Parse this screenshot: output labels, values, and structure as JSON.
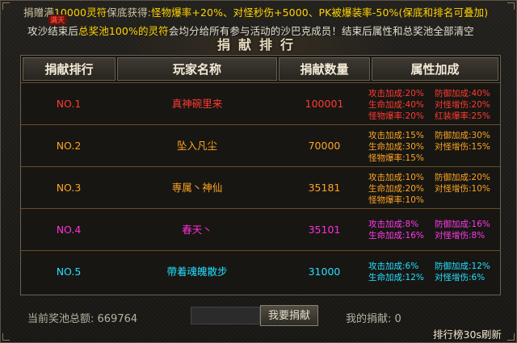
{
  "notice": {
    "line1_prefix": "捐赠满",
    "line1_amount": "10000灵符",
    "line1_mid": "保底获得:",
    "line1_rewards": "怪物爆率+20%、对怪秒伤+5000、PK被爆装率-50%(保底和排名可叠加)",
    "line2_a": "攻沙结束后",
    "line2_b": "总奖池100%的灵符",
    "line2_c": "会均分给所有参与活动的沙巴克成员！结束后属性和总奖池全部清空",
    "tag": "满天"
  },
  "title": "捐献排行",
  "headers": [
    "捐献排行",
    "玩家名称",
    "捐献数量",
    "属性加成"
  ],
  "colors": {
    "rank_red": "#ff3b2f",
    "rank_orange": "#ffa422",
    "rank_magenta": "#ff2fd6",
    "rank_cyan": "#24e0ff",
    "attr_red": "#ff3b2f",
    "attr_orange": "#ffa422",
    "attr_magenta": "#ff3be8",
    "attr_cyan": "#24e0ff"
  },
  "rows": [
    {
      "rank": "NO.1",
      "name": "真神碗里来",
      "amount": "100001",
      "attrs": [
        "攻击加成:20%",
        "防御加成:40%",
        "生命加成:40%",
        "对怪增伤:20%",
        "怪物爆率:20%",
        "红装爆率:25%"
      ]
    },
    {
      "rank": "NO.2",
      "name": "坠入凡尘",
      "amount": "70000",
      "attrs": [
        "攻击加成:15%",
        "防御加成:30%",
        "生命加成:30%",
        "对怪增伤:15%",
        "怪物爆率:15%"
      ]
    },
    {
      "rank": "NO.3",
      "name": "専属丶神仙",
      "amount": "35181",
      "attrs": [
        "攻击加成:10%",
        "防御加成:20%",
        "生命加成:20%",
        "对怪增伤:10%",
        "怪物爆率:10%"
      ]
    },
    {
      "rank": "NO.4",
      "name": "春天丶",
      "amount": "35101",
      "attrs": [
        "攻击加成:8%",
        "防御加成:16%",
        "生命加成:16%",
        "对怪增伤:8%"
      ]
    },
    {
      "rank": "NO.5",
      "name": "帶着魂魄散步",
      "amount": "31000",
      "attrs": [
        "攻击加成:6%",
        "防御加成:12%",
        "生命加成:12%",
        "对怪增伤:6%"
      ]
    }
  ],
  "footer": {
    "pool_label": "当前奖池总额: 669764",
    "input_value": "",
    "donate_button": "我要捐献",
    "my_donation": "我的捐献: 0",
    "refresh_note": "排行榜30s刷新"
  }
}
